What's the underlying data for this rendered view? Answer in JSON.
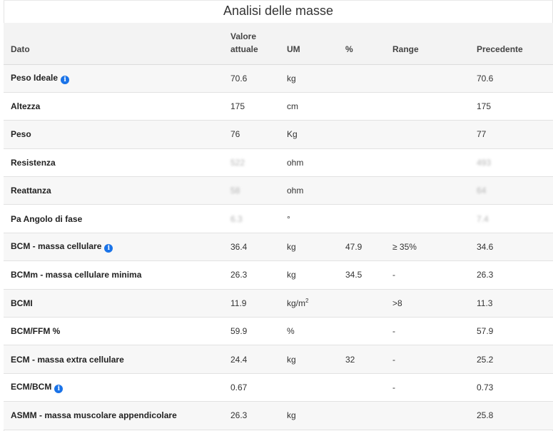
{
  "title": "Analisi delle masse",
  "headers": {
    "dato": "Dato",
    "valore_line1": "Valore",
    "valore_line2": "attuale",
    "um": "UM",
    "perc": "%",
    "range": "Range",
    "precedente": "Precedente"
  },
  "rows": [
    {
      "label": "Peso Ideale",
      "info": true,
      "value": "70.6",
      "um": "kg",
      "perc": "",
      "range": "",
      "prev": "70.6"
    },
    {
      "label": "Altezza",
      "value": "175",
      "um": "cm",
      "perc": "",
      "range": "",
      "prev": "175"
    },
    {
      "label": "Peso",
      "value": "76",
      "um": "Kg",
      "perc": "",
      "range": "",
      "prev": "77"
    },
    {
      "label": "Resistenza",
      "value": "522",
      "um": "ohm",
      "perc": "",
      "range": "",
      "prev": "493",
      "redacted": true
    },
    {
      "label": "Reattanza",
      "value": "58",
      "um": "ohm",
      "perc": "",
      "range": "",
      "prev": "64",
      "redacted": true
    },
    {
      "label": "Pa Angolo di fase",
      "value": "6.3",
      "um": "°",
      "perc": "",
      "range": "",
      "prev": "7.4",
      "redacted": true
    },
    {
      "label": "BCM - massa cellulare",
      "info": true,
      "value": "36.4",
      "um": "kg",
      "perc": "47.9",
      "range": "≥ 35%",
      "prev": "34.6"
    },
    {
      "label": "BCMm - massa cellulare minima",
      "value": "26.3",
      "um": "kg",
      "perc": "34.5",
      "range": "-",
      "prev": "26.3"
    },
    {
      "label": "BCMI",
      "value": "11.9",
      "um": "kg/m",
      "um_sup": "2",
      "perc": "",
      "range": ">8",
      "prev": "11.3"
    },
    {
      "label": "BCM/FFM %",
      "value": "59.9",
      "um": "%",
      "perc": "",
      "range": "-",
      "prev": "57.9"
    },
    {
      "label": "ECM - massa extra cellulare",
      "value": "24.4",
      "um": "kg",
      "perc": "32",
      "range": "-",
      "prev": "25.2"
    },
    {
      "label": "ECM/BCM",
      "info": true,
      "value": "0.67",
      "um": "",
      "perc": "",
      "range": "-",
      "prev": "0.73"
    },
    {
      "label": "ASMM - massa muscolare appendicolare",
      "value": "26.3",
      "um": "kg",
      "perc": "",
      "range": "",
      "prev": "25.8"
    }
  ],
  "colors": {
    "info_icon": "#1a73e8",
    "header_bg": "#f3f3f3",
    "row_alt": "#f7f7f7"
  },
  "icons": {
    "info": "info-circle-icon"
  }
}
